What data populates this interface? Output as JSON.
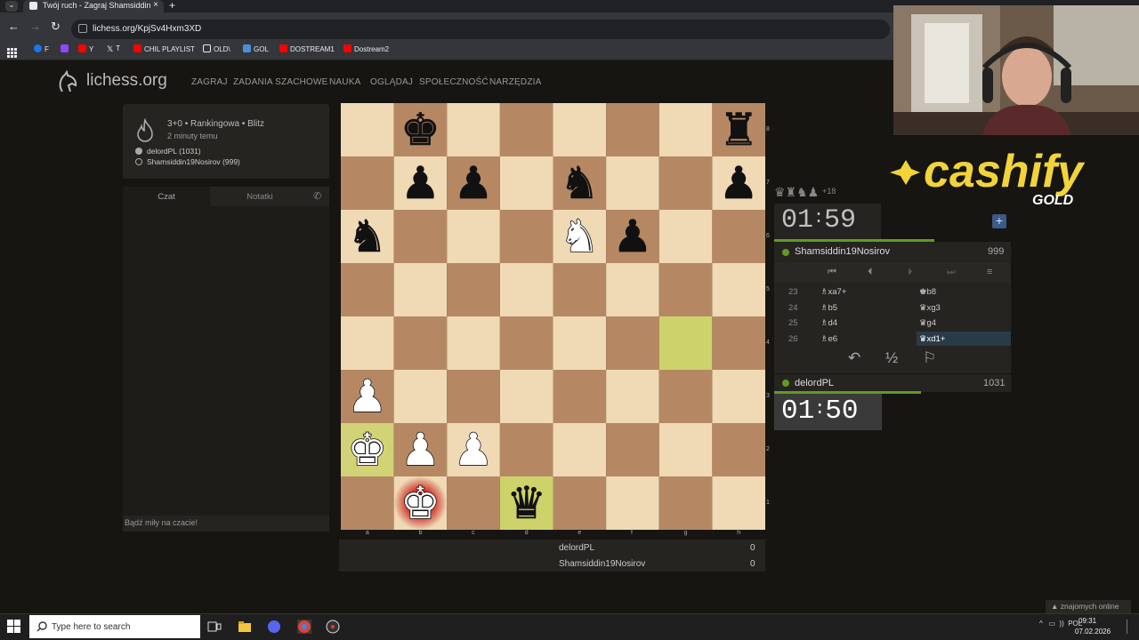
{
  "browser": {
    "tab_title": "Twój ruch - Zagraj Shamsiddin",
    "url": "lichess.org/KpjSv4Hxm3XD",
    "bookmarks": [
      "F",
      "Y",
      "T",
      "CHIL PLAYLIST",
      "OLD\\",
      "GOL",
      "DOSTREAM1",
      "Dostream2"
    ]
  },
  "site": {
    "logo": "lichess.org",
    "nav": [
      "ZAGRAJ",
      "ZADANIA SZACHOWE",
      "NAUKA",
      "OGLĄDAJ",
      "SPOŁECZNOŚĆ",
      "NARZĘDZIA"
    ]
  },
  "game_info": {
    "title": "3+0 • Rankingowa • Blitz",
    "time_ago": "2 minuty temu",
    "white": "delordPL (1031)",
    "black": "Shamsiddin19Nosirov (999)"
  },
  "chat": {
    "tab_chat": "Czat",
    "tab_notes": "Notatki",
    "placeholder": "Bądź miły na czacie!"
  },
  "board": {
    "ranks": [
      "8",
      "7",
      "6",
      "5",
      "4",
      "3",
      "2",
      "1"
    ],
    "files": [
      "a",
      "b",
      "c",
      "d",
      "e",
      "f",
      "g",
      "h"
    ],
    "pieces": [
      {
        "sq": "b8",
        "p": "bK"
      },
      {
        "sq": "h8",
        "p": "bR"
      },
      {
        "sq": "b7",
        "p": "bP"
      },
      {
        "sq": "c7",
        "p": "bP"
      },
      {
        "sq": "e7",
        "p": "bN"
      },
      {
        "sq": "h7",
        "p": "bP"
      },
      {
        "sq": "a6",
        "p": "bN"
      },
      {
        "sq": "e6",
        "p": "wN"
      },
      {
        "sq": "f6",
        "p": "bP"
      },
      {
        "sq": "a3",
        "p": "wP"
      },
      {
        "sq": "a2",
        "p": "wK"
      },
      {
        "sq": "b2",
        "p": "wP"
      },
      {
        "sq": "c2",
        "p": "wP"
      },
      {
        "sq": "b1",
        "p": "wK"
      },
      {
        "sq": "d1",
        "p": "bQ"
      }
    ],
    "last_move": [
      "g4",
      "d1"
    ],
    "check_square": "b1",
    "highlight_square": "a2"
  },
  "scores": {
    "p1": "delordPL",
    "p1_score": "0",
    "p2": "Shamsiddin19Nosirov",
    "p2_score": "0"
  },
  "panel": {
    "material": "+18",
    "clock_top_m": "01",
    "clock_top_s": "59",
    "top_player": "Shamsiddin19Nosirov",
    "top_rating": "999",
    "moves": [
      {
        "n": "23",
        "w": "♗xa7+",
        "b": "♚b8"
      },
      {
        "n": "24",
        "w": "♗b5",
        "b": "♛xg3"
      },
      {
        "n": "25",
        "w": "♗d4",
        "b": "♛g4"
      },
      {
        "n": "26",
        "w": "♗e6",
        "b": "♛xd1+"
      }
    ],
    "draw": "½",
    "bottom_player": "delordPL",
    "bottom_rating": "1031",
    "clock_bot_m": "01",
    "clock_bot_s": "50"
  },
  "overlay": {
    "brand": "cashify",
    "brand_sub": "GOLD"
  },
  "friends": "znajomych online",
  "taskbar": {
    "search_placeholder": "Type here to search",
    "lang": "POL",
    "time": "09:31",
    "date": "07.02.2026"
  },
  "colors": {
    "light": "#f0d9b5",
    "dark": "#b58863",
    "lastmove": "#cdd26a",
    "online": "#629924"
  }
}
